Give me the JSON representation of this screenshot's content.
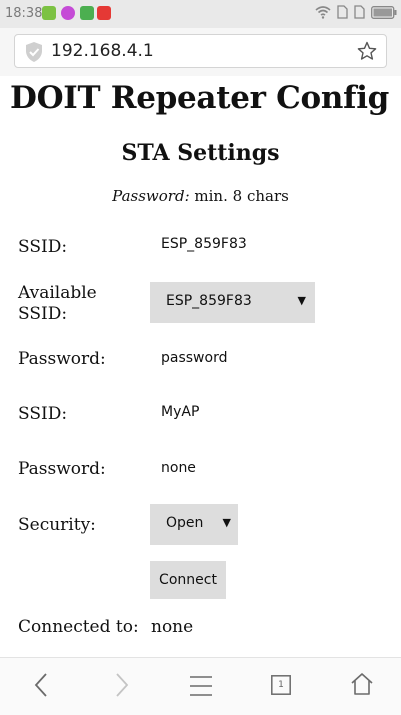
{
  "status_bar": {
    "time": "18:38",
    "app_icons": [
      "plus-app-icon",
      "e-browser-icon",
      "gallery-app-icon",
      "red-app-icon"
    ],
    "app_colors": [
      "#7cc243",
      "#c54bd6",
      "#4caf50",
      "#e53935"
    ],
    "right_icons": [
      "wifi-icon",
      "sim-icon",
      "sim-icon",
      "battery-icon"
    ]
  },
  "browser": {
    "url": "192.168.4.1",
    "shield_icon": "shield-icon",
    "bookmark_icon": "star-icon"
  },
  "page": {
    "title": "DOIT Repeater Config",
    "section_title": "STA Settings",
    "hint_label": "Password:",
    "hint_text": " min. 8 chars"
  },
  "form": {
    "ssid_label": "SSID:",
    "ssid_value": "ESP_859F83",
    "available_label_line1": "Available",
    "available_label_line2": "SSID:",
    "available_selected": "ESP_859F83",
    "password_label": "Password:",
    "password_value": "password",
    "ap_ssid_label": "SSID:",
    "ap_ssid_value": "MyAP",
    "ap_password_label": "Password:",
    "ap_password_value": "none",
    "security_label": "Security:",
    "security_selected": "Open",
    "connect_button": "Connect",
    "connected_label": "Connected to:",
    "connected_value": "none"
  },
  "bottom_nav": {
    "tab_count": "1",
    "icons": [
      "back-icon",
      "forward-icon",
      "menu-icon",
      "tabs-icon",
      "home-icon"
    ]
  }
}
